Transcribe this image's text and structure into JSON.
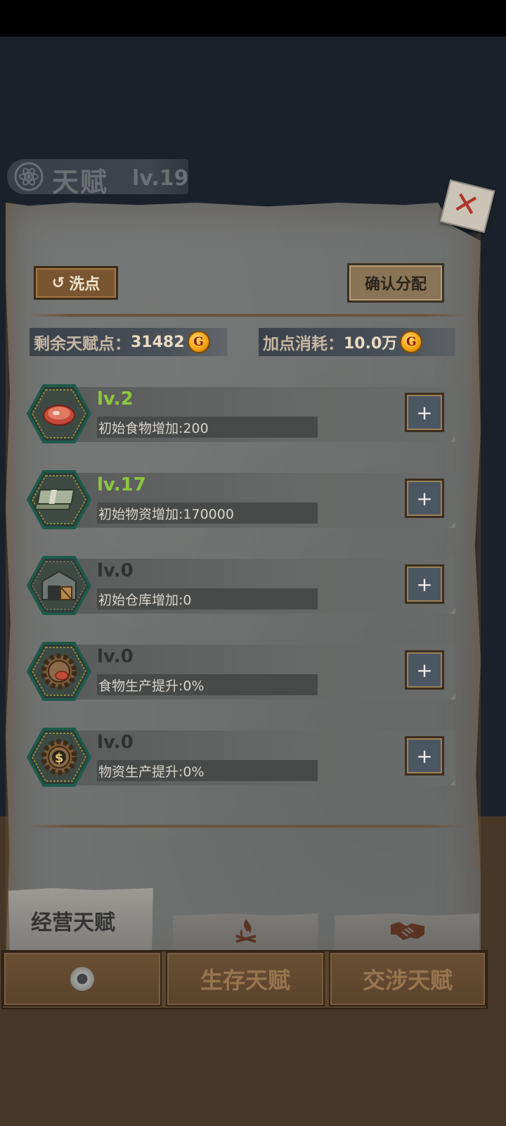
{
  "header": {
    "title": "天赋",
    "level": "lv.19",
    "icon": "atom-icon"
  },
  "actions": {
    "reset_label": "洗点",
    "confirm_label": "确认分配"
  },
  "stats": {
    "remaining_label": "剩余天赋点：",
    "remaining_value": "31482",
    "cost_label": "加点消耗：",
    "cost_value": "10.0万",
    "coin_symbol": "G"
  },
  "talents": [
    {
      "level": "lv.2",
      "desc": "初始食物增加:200",
      "icon": "meat-icon",
      "active": true
    },
    {
      "level": "lv.17",
      "desc": "初始物资增加:170000",
      "icon": "cash-stack-icon",
      "active": true
    },
    {
      "level": "lv.0",
      "desc": "初始仓库增加:0",
      "icon": "warehouse-icon",
      "active": false
    },
    {
      "level": "lv.0",
      "desc": "食物生产提升:0%",
      "icon": "gear-meat-icon",
      "active": false
    },
    {
      "level": "lv.0",
      "desc": "物资生产提升:0%",
      "icon": "gear-dollar-icon",
      "active": false
    }
  ],
  "plus_label": "+",
  "tabs": {
    "active_label": "经营天赋",
    "survival_icon": "campfire-icon",
    "negotiation_icon": "handshake-icon"
  },
  "nav": {
    "survival_label": "生存天赋",
    "negotiation_label": "交涉天赋"
  },
  "colors": {
    "active_level": "#8ec63f",
    "inactive_level": "#2f3230",
    "paper": "#6f7170"
  }
}
